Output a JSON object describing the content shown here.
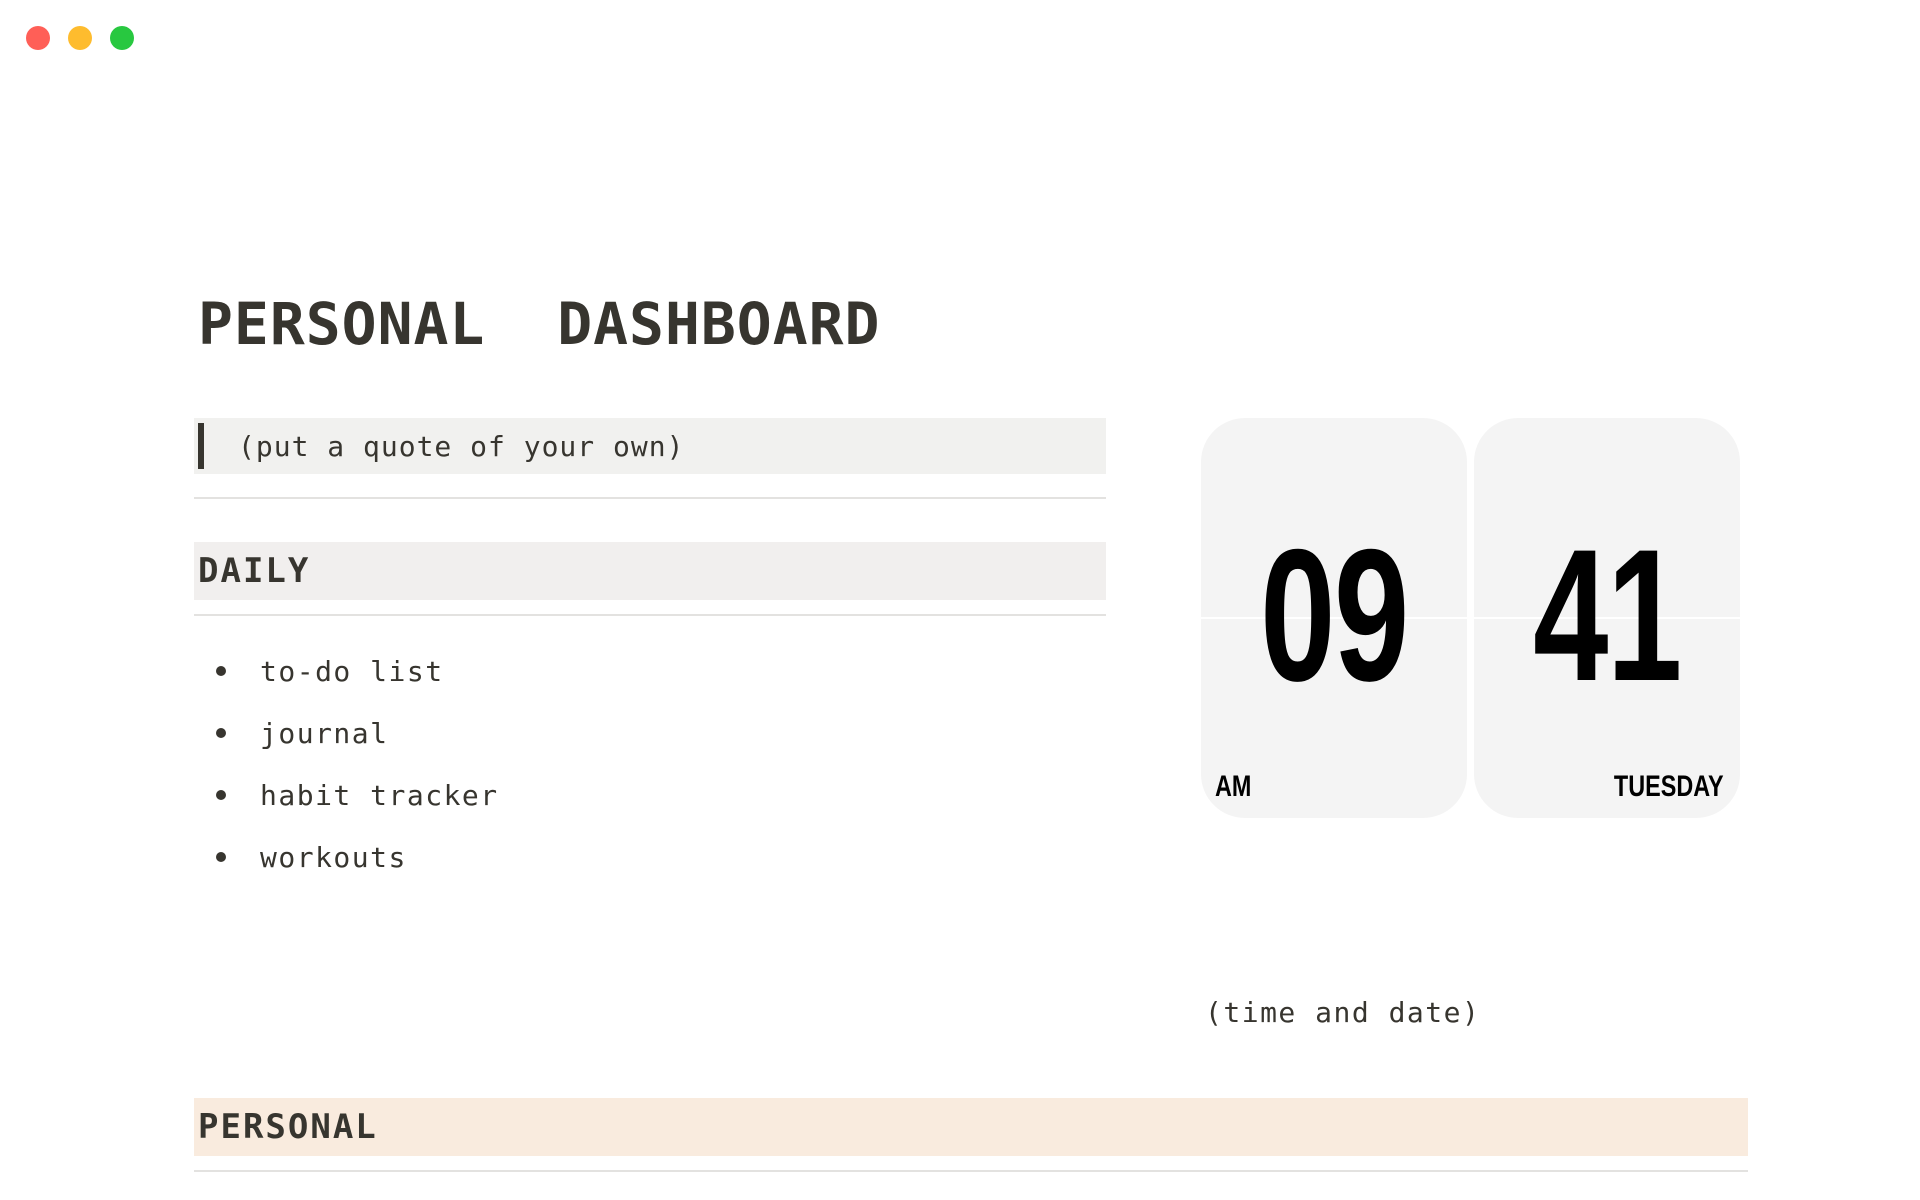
{
  "window": {
    "controls": [
      "close",
      "minimize",
      "maximize"
    ],
    "colors": {
      "close": "#ff5f57",
      "minimize": "#febc2e",
      "maximize": "#28c840"
    }
  },
  "page": {
    "title": "PERSONAL  DASHBOARD",
    "quote": "(put a quote of your own)"
  },
  "daily": {
    "heading": "DAILY",
    "background": "#f1efee",
    "items": [
      {
        "label": "to-do list"
      },
      {
        "label": "journal"
      },
      {
        "label": "habit tracker"
      },
      {
        "label": "workouts"
      }
    ]
  },
  "clock": {
    "hours": "09",
    "minutes": "41",
    "period": "AM",
    "day": "TUESDAY",
    "caption": "(time and date)"
  },
  "personal": {
    "heading": "PERSONAL",
    "background": "#f9ebde"
  }
}
